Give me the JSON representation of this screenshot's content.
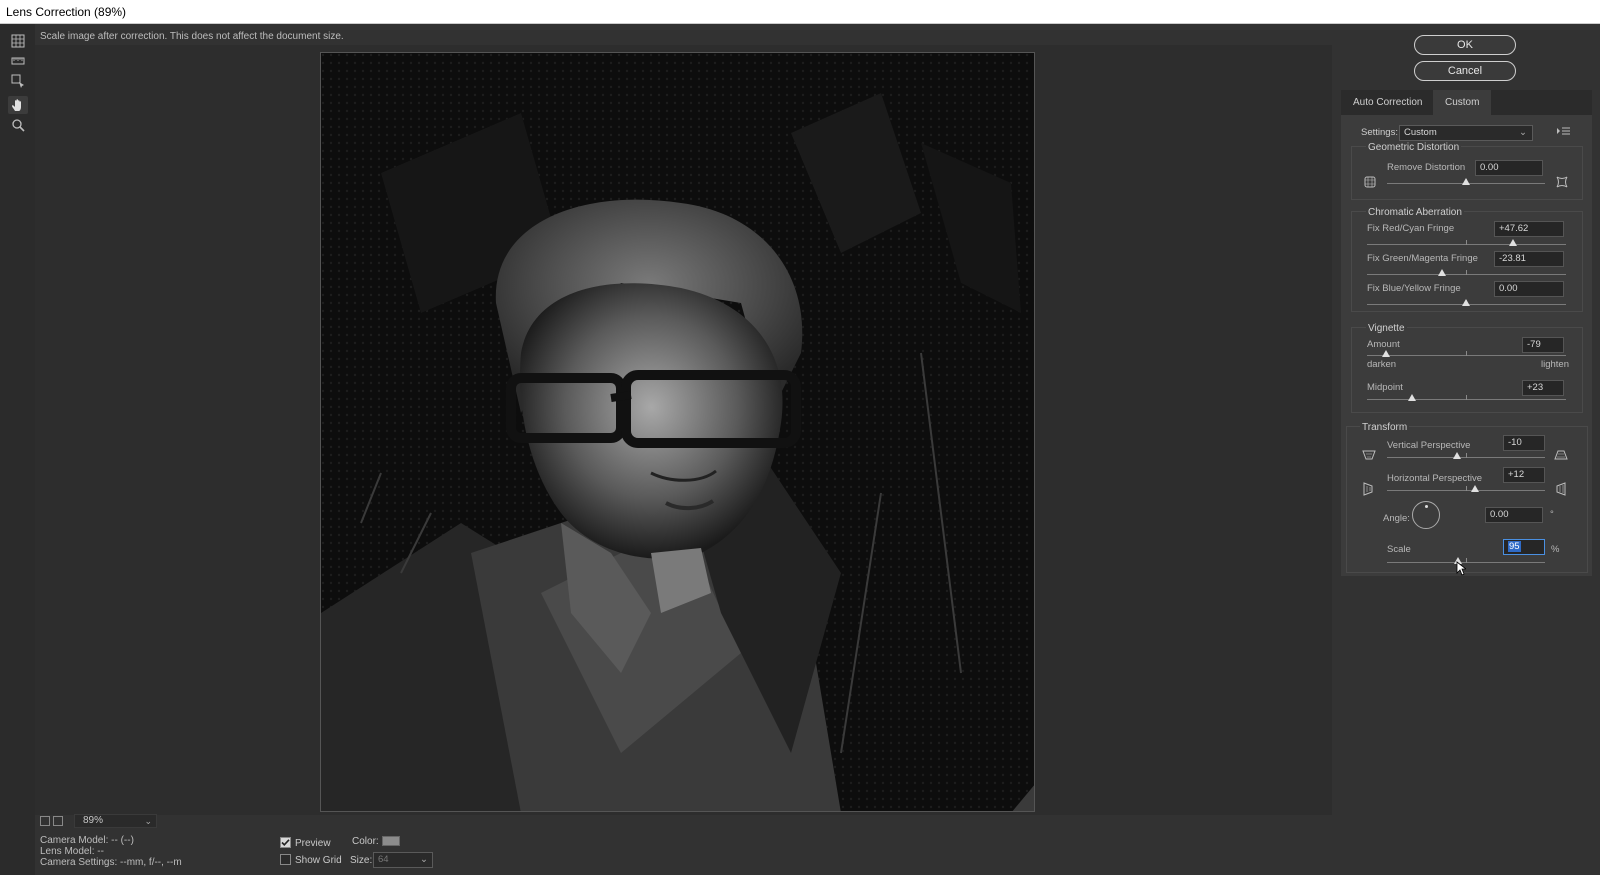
{
  "window": {
    "title": "Lens Correction (89%)"
  },
  "hint": "Scale image after correction. This does not affect the document size.",
  "tools": [
    "remove-distortion-tool-icon",
    "straighten-tool-icon",
    "move-grid-tool-icon",
    "hand-tool-icon",
    "zoom-tool-icon"
  ],
  "zoom": {
    "value": "89%"
  },
  "info": {
    "camera_model": "Camera Model: -- (--)",
    "lens_model": "Lens Model: --",
    "camera_settings": "Camera Settings: --mm, f/--, --m"
  },
  "preview": {
    "label": "Preview",
    "checked": true
  },
  "show_grid": {
    "label": "Show Grid",
    "checked": false
  },
  "grid": {
    "color_label": "Color:",
    "color": "#8c8c8c",
    "size_label": "Size:",
    "size_value": "64"
  },
  "buttons": {
    "ok": "OK",
    "cancel": "Cancel"
  },
  "tabs": {
    "auto": "Auto Correction",
    "custom": "Custom"
  },
  "settings": {
    "label": "Settings:",
    "value": "Custom"
  },
  "geometric": {
    "title": "Geometric Distortion",
    "remove_label": "Remove Distortion",
    "remove_value": "0.00"
  },
  "chromatic": {
    "title": "Chromatic Aberration",
    "red_label": "Fix Red/Cyan Fringe",
    "red_value": "+47.62",
    "green_label": "Fix Green/Magenta Fringe",
    "green_value": "-23.81",
    "blue_label": "Fix Blue/Yellow Fringe",
    "blue_value": "0.00"
  },
  "vignette": {
    "title": "Vignette",
    "amount_label": "Amount",
    "amount_value": "-79",
    "darken": "darken",
    "lighten": "lighten",
    "midpoint_label": "Midpoint",
    "midpoint_value": "+23"
  },
  "transform": {
    "title": "Transform",
    "vertical_label": "Vertical Perspective",
    "vertical_value": "-10",
    "horizontal_label": "Horizontal Perspective",
    "horizontal_value": "+12",
    "angle_label": "Angle:",
    "angle_value": "0.00",
    "angle_unit": "°",
    "scale_label": "Scale",
    "scale_value": "95",
    "scale_unit": "%"
  }
}
